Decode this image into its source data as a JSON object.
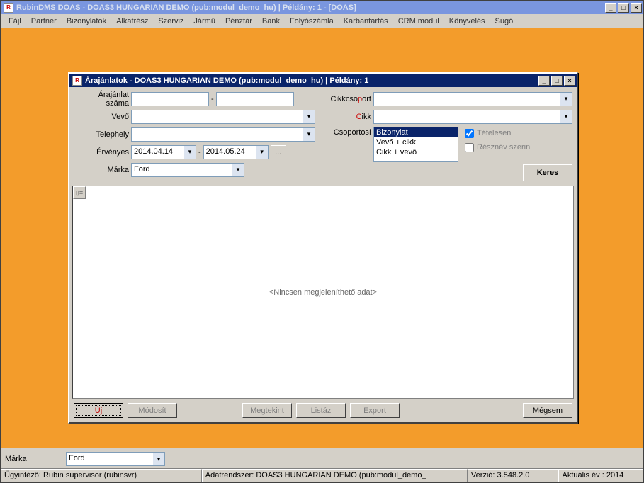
{
  "main_title": "RubinDMS DOAS - DOAS3 HUNGARIAN DEMO (pub:modul_demo_hu) | Példány: 1 - [DOAS]",
  "menu": [
    "Fájl",
    "Partner",
    "Bizonylatok",
    "Alkatrész",
    "Szerviz",
    "Jármű",
    "Pénztár",
    "Bank",
    "Folyószámla",
    "Karbantartás",
    "CRM modul",
    "Könyvelés",
    "Súgó"
  ],
  "inner_title": "Árajánlatok - DOAS3 HUNGARIAN DEMO (pub:modul_demo_hu) | Példány: 1",
  "labels": {
    "arajanlat_szama": "Árajánlat száma",
    "vevo": "Vevő",
    "telephely": "Telephely",
    "ervenyes": "Érvényes",
    "marka": "Márka",
    "cikkcsoport_pre": "Cikkcso",
    "cikkcsoport_hot": "p",
    "cikkcsoport_post": "ort",
    "cikk_hot": "C",
    "cikk_post": "ikk",
    "csoportosi": "Csoportosí",
    "dash": "-"
  },
  "fields": {
    "arajanlat_szama_1": "",
    "arajanlat_szama_2": "",
    "vevo": "",
    "telephely": "",
    "date_from": "2014.04.14",
    "date_to": "2014.05.24",
    "marka": "Ford",
    "cikkcsoport": "",
    "cikk": ""
  },
  "csoportosi_options": [
    "Bizonylat",
    "Vevő + cikk",
    "Cikk + vevő"
  ],
  "csoportosi_selected": "Bizonylat",
  "checkboxes": {
    "tetelesen_label": "Tételesen",
    "tetelesen_checked": true,
    "resznev_label": "Résznév szerin",
    "resznev_checked": false
  },
  "buttons": {
    "keres": "Keres",
    "uj": "Új",
    "modosit": "Módosít",
    "megtekint": "Megtekint",
    "listaz": "Listáz",
    "export": "Export",
    "megsem": "Mégsem",
    "ellipsis": "..."
  },
  "grid_empty": "<Nincsen megjeleníthető adat>",
  "bottom": {
    "marka_label": "Márka",
    "marka_value": "Ford"
  },
  "status": {
    "ugyintezo": "Ügyintéző: Rubin supervisor (rubinsvr)",
    "adatrendszer": "Adatrendszer: DOAS3 HUNGARIAN DEMO (pub:modul_demo_",
    "verzio": "Verzió: 3.548.2.0",
    "aktualis_ev": "Aktuális év : 2014"
  }
}
